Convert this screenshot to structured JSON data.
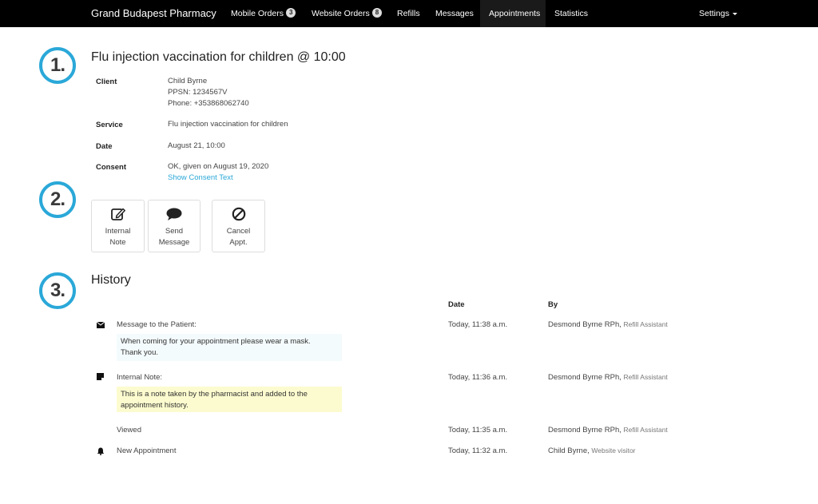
{
  "nav": {
    "brand": "Grand Budapest Pharmacy",
    "items": [
      {
        "label": "Mobile Orders",
        "badge": "3"
      },
      {
        "label": "Website Orders",
        "badge": "8"
      },
      {
        "label": "Refills"
      },
      {
        "label": "Messages"
      },
      {
        "label": "Appointments"
      },
      {
        "label": "Statistics"
      }
    ],
    "settings": "Settings"
  },
  "steps": [
    "1.",
    "2.",
    "3."
  ],
  "appointment": {
    "title": "Flu injection vaccination for children @ 10:00",
    "client_label": "Client",
    "client_name": "Child Byrne",
    "client_ppsn": "PPSN: 1234567V",
    "client_phone": "Phone: +353868062740",
    "service_label": "Service",
    "service_value": "Flu injection vaccination for children",
    "date_label": "Date",
    "date_value": "August 21, 10:00",
    "consent_label": "Consent",
    "consent_value": "OK, given on August 19, 2020",
    "consent_link": "Show Consent Text"
  },
  "actions": [
    {
      "line1": "Internal",
      "line2": "Note",
      "icon": "edit-icon"
    },
    {
      "line1": "Send",
      "line2": "Message",
      "icon": "speech-bubble-icon"
    },
    {
      "line1": "Cancel",
      "line2": "Appt.",
      "icon": "ban-icon"
    }
  ],
  "history": {
    "title": "History",
    "col_date": "Date",
    "col_by": "By",
    "entries": [
      {
        "type": "Message to the Patient:",
        "icon": "envelope-icon",
        "note_line1": "When coming for your appointment please wear a mask.",
        "note_line2": "Thank you.",
        "date": "Today, 11:38 a.m.",
        "by": "Desmond Byrne RPh,",
        "role": "Refill Assistant"
      },
      {
        "type": "Internal Note:",
        "icon": "note-icon",
        "note_line1": "This is a note taken by the pharmacist and added to the",
        "note_line2": "appointment history.",
        "date": "Today, 11:36 a.m.",
        "by": "Desmond Byrne RPh,",
        "role": "Refill Assistant"
      },
      {
        "type": "Viewed",
        "date": "Today, 11:35 a.m.",
        "by": "Desmond Byrne RPh,",
        "role": "Refill Assistant"
      },
      {
        "type": "New Appointment",
        "icon": "bell-icon",
        "date": "Today, 11:32 a.m.",
        "by": "Child Byrne,",
        "role": "Website visitor"
      }
    ]
  }
}
